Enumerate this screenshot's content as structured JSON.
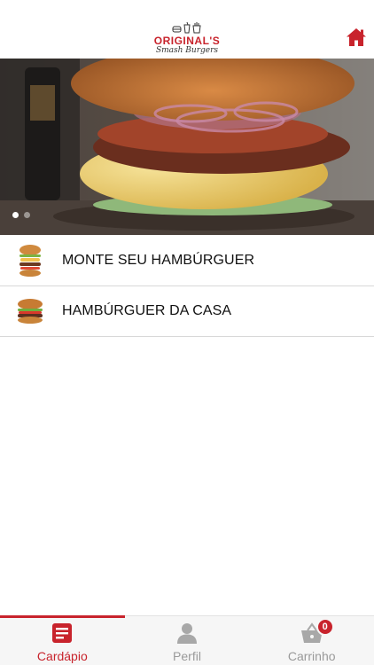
{
  "header": {
    "logo_title": "ORIGINAL'S",
    "logo_subtitle": "Smash Burgers",
    "home_icon": "home-icon"
  },
  "carousel": {
    "slide_count": 2,
    "active_index": 0
  },
  "menu": {
    "items": [
      {
        "label": "MONTE SEU HAMBÚRGUER",
        "icon": "stacked-burger-icon"
      },
      {
        "label": "HAMBÚRGUER DA CASA",
        "icon": "house-burger-icon"
      }
    ]
  },
  "tabbar": {
    "tabs": [
      {
        "label": "Cardápio",
        "icon": "menu-list-icon",
        "active": true
      },
      {
        "label": "Perfil",
        "icon": "user-icon",
        "active": false
      },
      {
        "label": "Carrinho",
        "icon": "basket-icon",
        "active": false,
        "badge": "0"
      }
    ]
  },
  "colors": {
    "accent": "#c8232c",
    "inactive": "#9a9a9a",
    "tabbar_bg": "#f6f6f6"
  }
}
